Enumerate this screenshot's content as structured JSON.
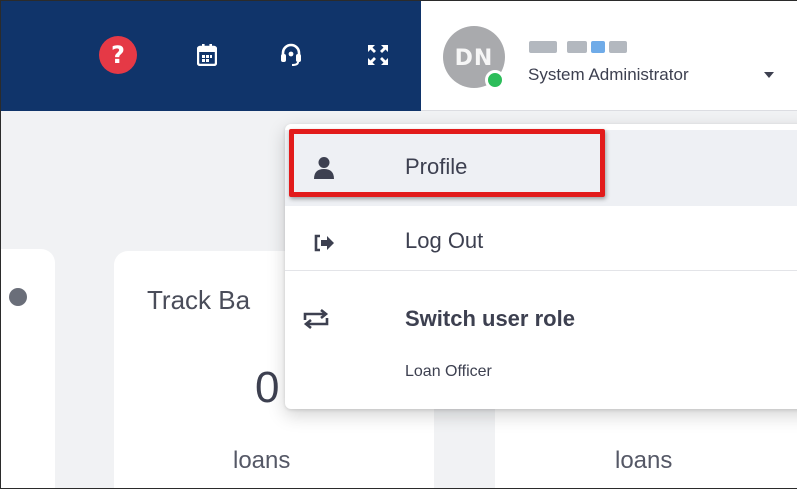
{
  "header": {
    "help_icon": "question-circle-icon",
    "help_glyph": "?",
    "calendar_icon": "calendar-icon",
    "support_icon": "headset-icon",
    "expand_icon": "expand-arrows-icon",
    "colors": {
      "nav": "#10346a",
      "help": "#e53946",
      "online": "#2dbd5a"
    }
  },
  "user": {
    "avatar_initials": "DN",
    "role": "System Administrator",
    "status": "online"
  },
  "dropdown": {
    "items": [
      {
        "label": "Profile",
        "icon": "user-icon"
      },
      {
        "label": "Log Out",
        "icon": "sign-out-icon"
      }
    ],
    "switch": {
      "title": "Switch user role",
      "icon": "switch-arrows-icon",
      "option": "Loan Officer"
    }
  },
  "cards": {
    "mid": {
      "title": "Track Ba",
      "value": "0",
      "unit": "loans"
    },
    "right": {
      "unit": "loans"
    }
  },
  "annotation": {
    "highlight_color": "#e21b1b"
  }
}
